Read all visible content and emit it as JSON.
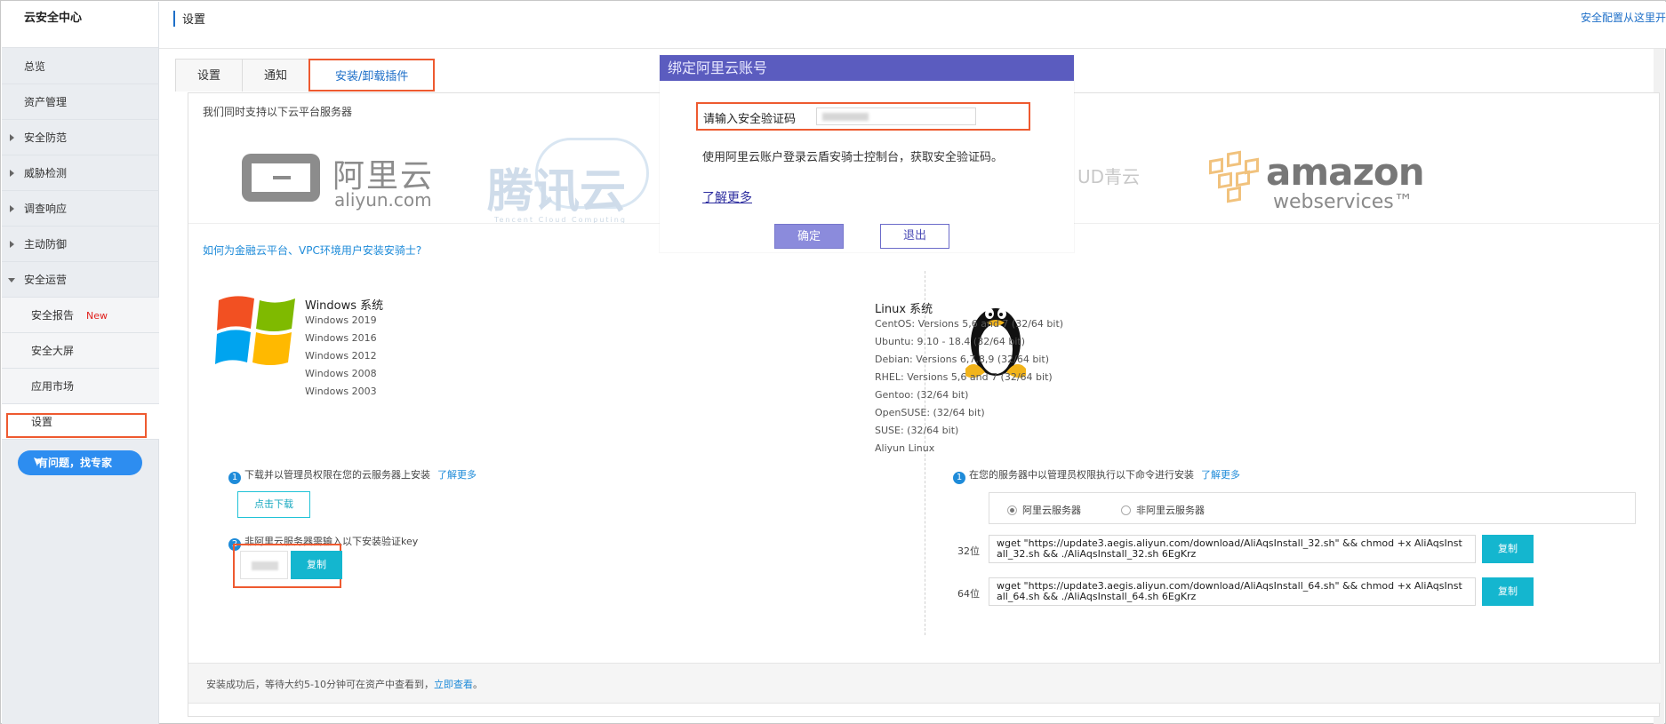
{
  "app": {
    "title": "云安全中心"
  },
  "header": {
    "title": "设置",
    "right_link": "安全配置从这里开"
  },
  "sidebar": {
    "items": [
      {
        "label": "总览"
      },
      {
        "label": "资产管理"
      },
      {
        "label": "安全防范"
      },
      {
        "label": "威胁检测"
      },
      {
        "label": "调查响应"
      },
      {
        "label": "主动防御"
      },
      {
        "label": "安全运营"
      },
      {
        "label": "安全报告",
        "badge": "New"
      },
      {
        "label": "安全大屏"
      },
      {
        "label": "应用市场"
      },
      {
        "label": "设置"
      }
    ],
    "expert_button": "有问题，找专家"
  },
  "tabs": [
    {
      "label": "设置"
    },
    {
      "label": "通知"
    },
    {
      "label": "安装/卸载插件"
    }
  ],
  "main": {
    "support_text": "我们同时支持以下云平台服务器",
    "logos": {
      "aliyun_cn": "阿里云",
      "aliyun_en": "aliyun.com",
      "tencent_cn": "腾讯云",
      "tencent_en": "Tencent Cloud Computing",
      "qing": "UD青云",
      "amazon_word": "amazon",
      "amazon_ws": "webservices™"
    },
    "vpc_link": "如何为金融云平台、VPC环境用户安装安骑士?",
    "windows": {
      "title": "Windows 系统",
      "versions": [
        "Windows 2019",
        "Windows 2016",
        "Windows 2012",
        "Windows 2008",
        "Windows 2003"
      ],
      "step1": "下载并以管理员权限在您的云服务器上安装",
      "step1_more": "了解更多",
      "download_btn": "点击下载",
      "step2": "非阿里云服务器需输入以下安装验证key",
      "copy_btn": "复制"
    },
    "linux": {
      "title": "Linux 系统",
      "versions": [
        "CentOS: Versions 5,6 and 7 (32/64 bit)",
        "Ubuntu: 9.10 - 18.4 (32/64 bit)",
        "Debian: Versions 6,7,8,9 (32/64 bit)",
        "RHEL: Versions 5,6 and 7 (32/64 bit)",
        "Gentoo: (32/64 bit)",
        "OpenSUSE: (32/64 bit)",
        "SUSE: (32/64 bit)",
        "Aliyun Linux"
      ],
      "step1": "在您的服务器中以管理员权限执行以下命令进行安装",
      "step1_more": "了解更多",
      "radio_aliyun": "阿里云服务器",
      "radio_other": "非阿里云服务器",
      "cmd32_label": "32位",
      "cmd32": "wget \"https://update3.aegis.aliyun.com/download/AliAqsInstall_32.sh\" && chmod +x AliAqsInstall_32.sh && ./AliAqsInstall_32.sh 6EgKrz",
      "cmd64_label": "64位",
      "cmd64": "wget \"https://update3.aegis.aliyun.com/download/AliAqsInstall_64.sh\" && chmod +x AliAqsInstall_64.sh && ./AliAqsInstall_64.sh 6EgKrz",
      "copy_btn": "复制"
    },
    "footer_text": "安装成功后，等待大约5-10分钟可在资产中查看到，",
    "footer_link": "立即查看",
    "footer_end": "。"
  },
  "modal": {
    "title": "绑定阿里云账号",
    "input_label": "请输入安全验证码",
    "description": "使用阿里云账户登录云盾安骑士控制台，获取安全验证码。",
    "learn_more": "了解更多",
    "ok": "确定",
    "exit": "退出"
  },
  "colors": {
    "highlight": "#ee5a30",
    "link": "#1e8bd9",
    "modal_header": "#5b5cbf",
    "copy_button": "#14b6cf",
    "expert_button": "#2d8df0"
  }
}
